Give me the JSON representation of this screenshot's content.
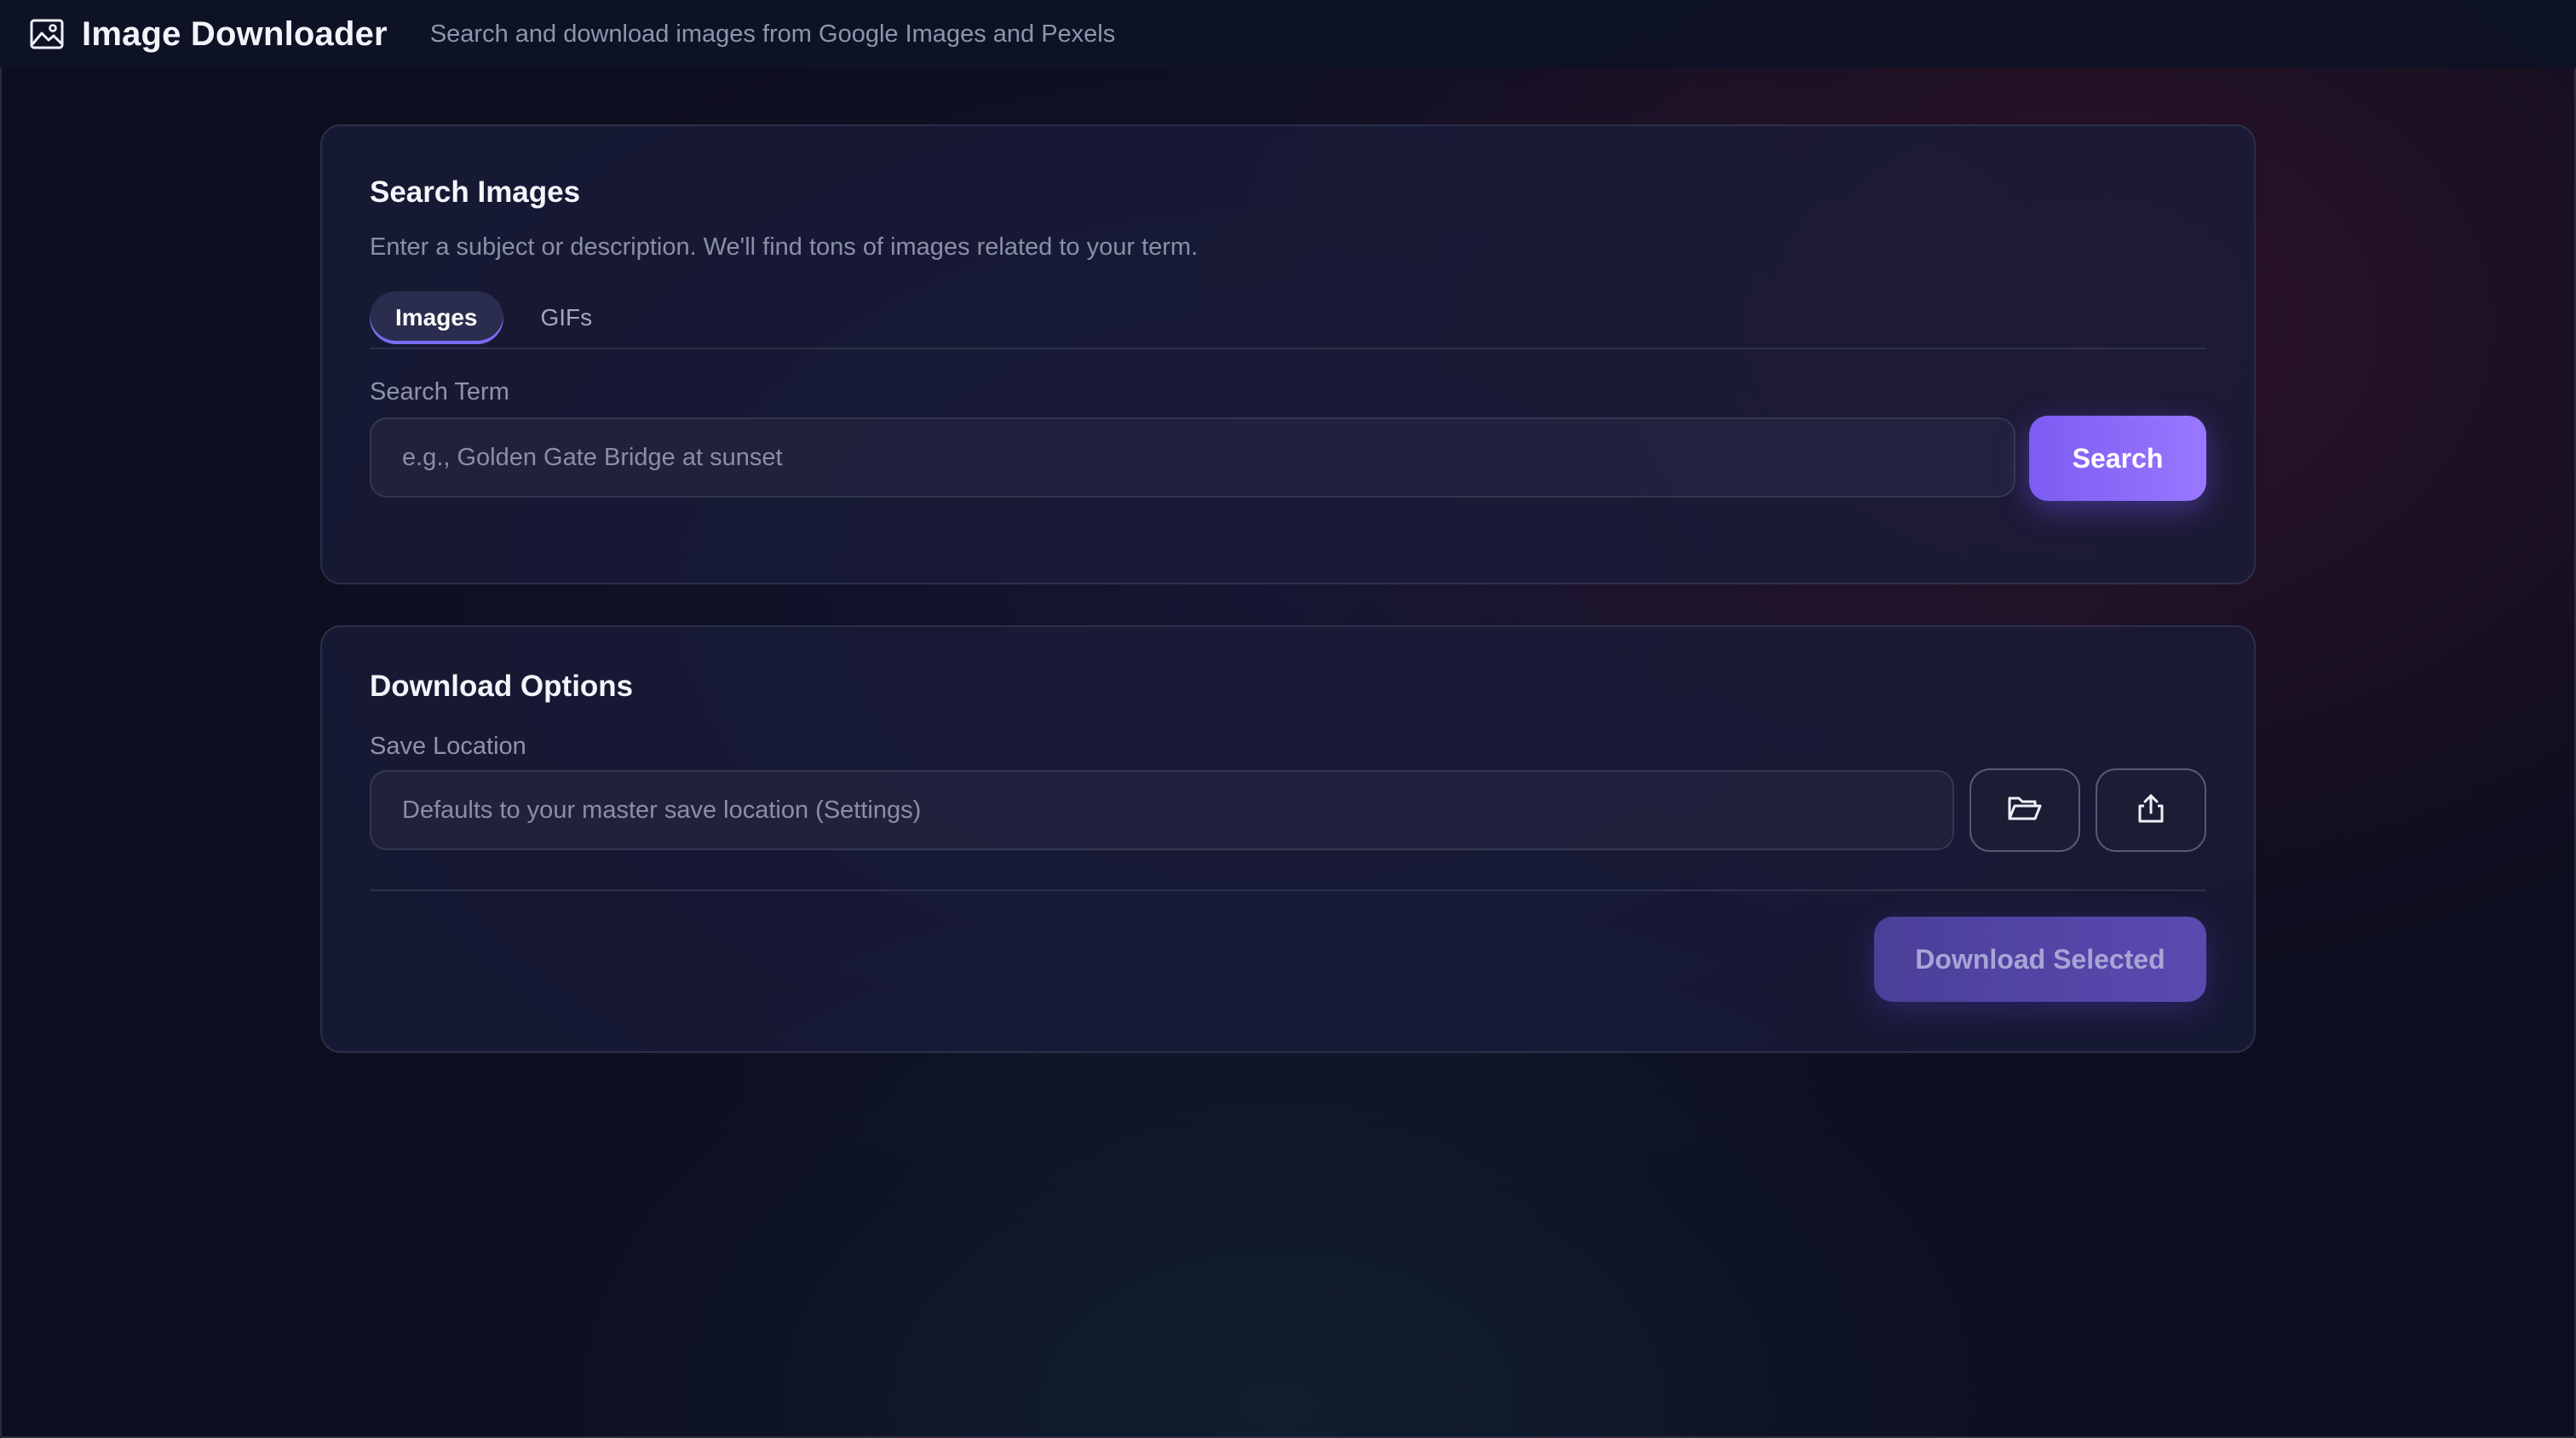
{
  "header": {
    "title": "Image Downloader",
    "subtitle": "Search and download images from Google Images and Pexels",
    "icon": "image-icon"
  },
  "search_card": {
    "title": "Search Images",
    "description": "Enter a subject or description. We'll find tons of images related to your term.",
    "tabs": [
      {
        "label": "Images",
        "active": true
      },
      {
        "label": "GIFs",
        "active": false
      }
    ],
    "search_term_label": "Search Term",
    "search_input": {
      "value": "",
      "placeholder": "e.g., Golden Gate Bridge at sunset"
    },
    "search_button_label": "Search"
  },
  "download_card": {
    "title": "Download Options",
    "save_location_label": "Save Location",
    "save_location_input": {
      "value": "",
      "placeholder": "Defaults to your master save location (Settings)"
    },
    "browse_icon": "folder-open-icon",
    "export_icon": "share-upload-icon",
    "download_button_label": "Download Selected",
    "download_button_disabled": true
  },
  "colors": {
    "accent": "#8b6cf7",
    "background": "#0d0e1f",
    "card": "#1a1c38"
  }
}
